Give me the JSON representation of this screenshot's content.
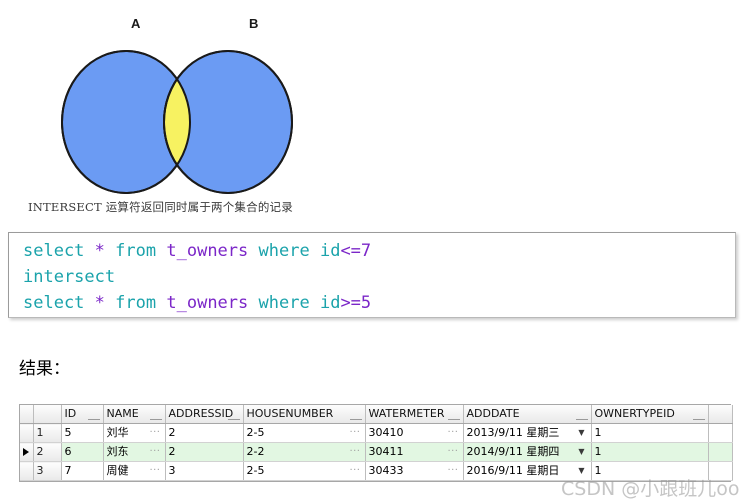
{
  "venn": {
    "label_a": "A",
    "label_b": "B",
    "caption": "INTERSECT 运算符返回同时属于两个集合的记录",
    "circle_fill": "#6b9bf3",
    "intersection_fill": "#f7f261",
    "stroke": "#1a1a1a"
  },
  "code": {
    "line1": {
      "kw1": "select",
      "star": "*",
      "kw2": "from",
      "table": "t_owners",
      "kw3": "where",
      "col": "id",
      "op": "<=",
      "num": "7"
    },
    "line2": {
      "kw": "intersect"
    },
    "line3": {
      "kw1": "select",
      "star": "*",
      "kw2": "from",
      "table": "t_owners",
      "kw3": "where",
      "col": "id",
      "op": ">=",
      "num": "5"
    },
    "colors": {
      "keyword": "#1ba3ab",
      "identifier": "#7b26c8",
      "operator": "#7b26c8",
      "number": "#7b26c8"
    }
  },
  "result_label": "结果：",
  "grid": {
    "headers": {
      "marker": "",
      "rownum": "",
      "id": "ID",
      "name": "NAME",
      "addressid": "ADDRESSID",
      "housenumber": "HOUSENUMBER",
      "watermeter": "WATERMETER",
      "adddate": "ADDDATE",
      "ownertypeid": "OWNERTYPEID",
      "tail": ""
    },
    "rows": [
      {
        "marker": "",
        "rownum": "1",
        "id": "5",
        "name": "刘华",
        "addressid": "2",
        "housenumber": "2-5",
        "watermeter": "30410",
        "adddate": "2013/9/11 星期三",
        "ownertypeid": "1",
        "selected": false
      },
      {
        "marker": "▶",
        "rownum": "2",
        "id": "6",
        "name": "刘东",
        "addressid": "2",
        "housenumber": "2-2",
        "watermeter": "30411",
        "adddate": "2014/9/11 星期四",
        "ownertypeid": "1",
        "selected": true
      },
      {
        "marker": "",
        "rownum": "3",
        "id": "7",
        "name": "周健",
        "addressid": "3",
        "housenumber": "2-5",
        "watermeter": "30433",
        "adddate": "2016/9/11 星期日",
        "ownertypeid": "1",
        "selected": false
      }
    ],
    "ellipsis_glyph": "···",
    "caret_glyph": "▼",
    "selected_row_color": "#e2f7e2"
  },
  "watermark": "CSDN @小跟班儿oo"
}
